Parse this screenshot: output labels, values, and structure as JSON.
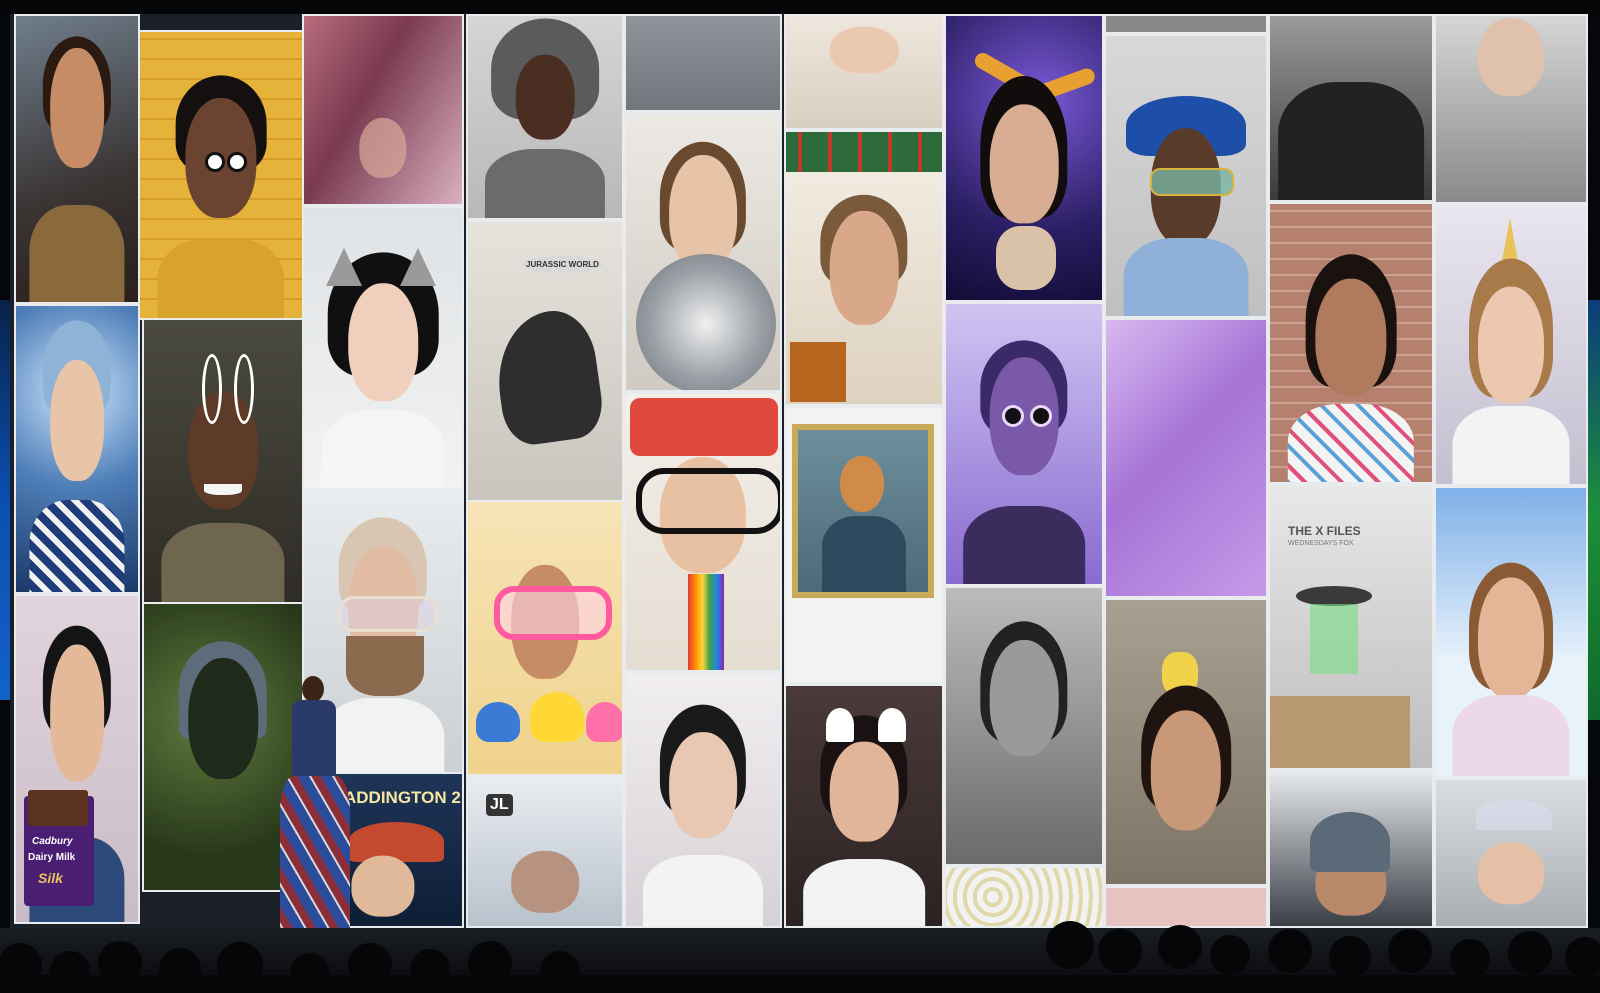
{
  "scene": {
    "description_kind": "keynote-stage-ar-effects-wall",
    "screen_background": "#1b1f27",
    "tile_border": "#e9ecef"
  },
  "overlays": {
    "paddington": "ADDINGTON 2",
    "jurassic": "JURASSIC WORLD",
    "xfiles": "THE X FILES",
    "xfiles_sub": "WEDNESDAYS FOX",
    "jl": "JL",
    "candy": "Dairy Milk",
    "candy_brand": "Cadbury",
    "candy_sub": "Silk"
  },
  "colors": {
    "skin_light": "#e8bfa3",
    "skin_medium": "#c58c66",
    "skin_dark": "#6b4331",
    "purple": "#8a6ad0",
    "yellow_wall": "#e5b23a",
    "space": "#2b1e63",
    "accent_blue": "#1262c8",
    "accent_green": "#1c8e3b"
  }
}
